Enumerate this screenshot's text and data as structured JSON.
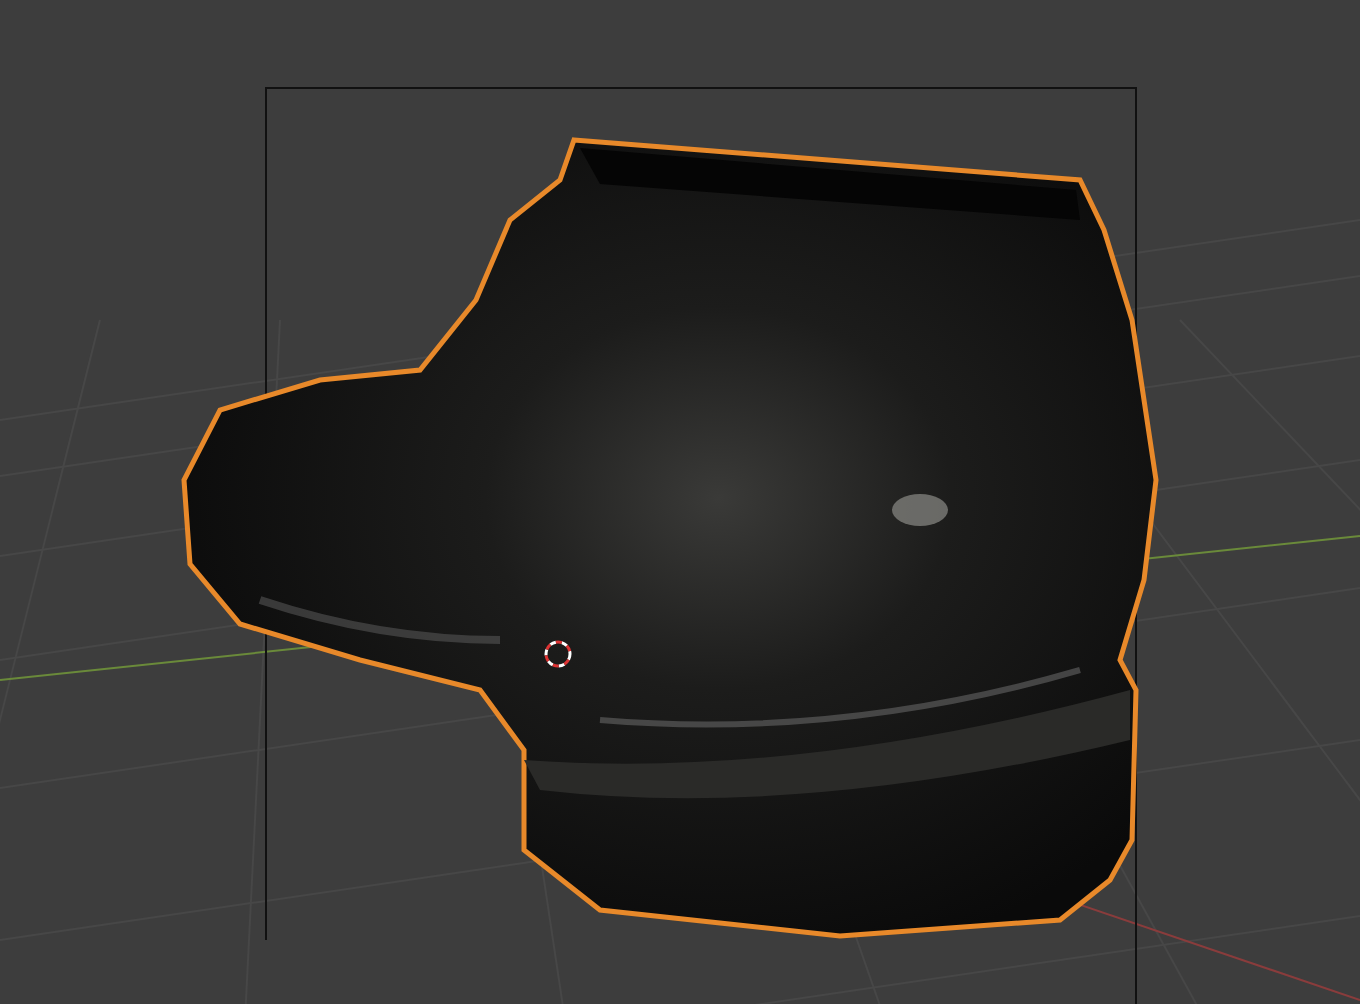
{
  "viewport": {
    "object_selected": true
  }
}
